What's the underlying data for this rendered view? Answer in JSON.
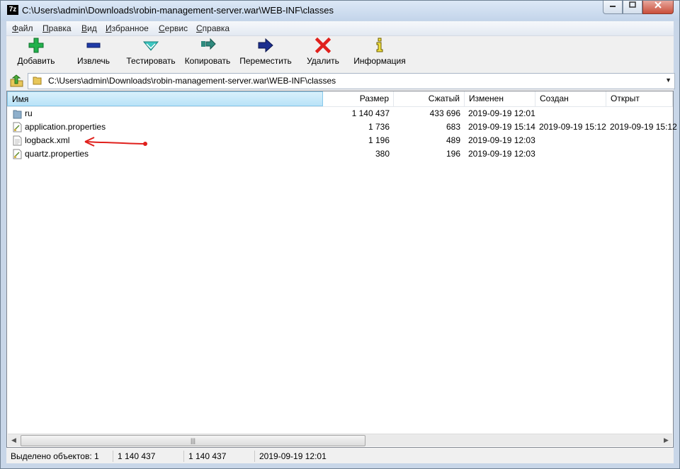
{
  "window": {
    "app_icon": "7z",
    "title": "C:\\Users\\admin\\Downloads\\robin-management-server.war\\WEB-INF\\classes",
    "buttons": [
      "minimize",
      "maximize",
      "close"
    ]
  },
  "menu": [
    {
      "label": "Файл",
      "accel": "Ф",
      "rest": "айл"
    },
    {
      "label": "Правка",
      "accel": "П",
      "rest": "равка"
    },
    {
      "label": "Вид",
      "accel": "В",
      "rest": "ид"
    },
    {
      "label": "Избранное",
      "accel": "И",
      "rest": "збранное"
    },
    {
      "label": "Сервис",
      "accel": "С",
      "rest": "ервис"
    },
    {
      "label": "Справка",
      "accel": "С",
      "rest": "правка"
    }
  ],
  "toolbar": {
    "add": {
      "label": "Добавить",
      "icon": "plus-icon",
      "color": "#22b14c"
    },
    "extract": {
      "label": "Извлечь",
      "icon": "minus-icon",
      "color": "#1f3ba8"
    },
    "test": {
      "label": "Тестировать",
      "icon": "check-down-icon",
      "color": "#3cc6c0"
    },
    "copy": {
      "label": "Копировать",
      "icon": "copy-arrow-icon",
      "color": "#2f8a7e"
    },
    "move": {
      "label": "Переместить",
      "icon": "right-arrow-icon",
      "color": "#1c2f8f"
    },
    "delete": {
      "label": "Удалить",
      "icon": "x-icon",
      "color": "#e0201c"
    },
    "info": {
      "label": "Информация",
      "icon": "info-icon",
      "color": "#f0e040"
    }
  },
  "address": {
    "path": "C:\\Users\\admin\\Downloads\\robin-management-server.war\\WEB-INF\\classes"
  },
  "columns": {
    "name": "Имя",
    "size": "Размер",
    "packed": "Сжатый",
    "modified": "Изменен",
    "created": "Создан",
    "accessed": "Открыт"
  },
  "files": [
    {
      "name": "ru",
      "type": "folder",
      "size": "1 140 437",
      "packed": "433 696",
      "modified": "2019-09-19 12:01",
      "created": "",
      "accessed": ""
    },
    {
      "name": "application.properties",
      "type": "file",
      "size": "1 736",
      "packed": "683",
      "modified": "2019-09-19 15:14",
      "created": "2019-09-19 15:12",
      "accessed": "2019-09-19 15:12"
    },
    {
      "name": "logback.xml",
      "type": "file",
      "size": "1 196",
      "packed": "489",
      "modified": "2019-09-19 12:03",
      "created": "",
      "accessed": ""
    },
    {
      "name": "quartz.properties",
      "type": "file",
      "size": "380",
      "packed": "196",
      "modified": "2019-09-19 12:03",
      "created": "",
      "accessed": ""
    }
  ],
  "status": {
    "selected": "Выделено объектов: 1",
    "size": "1 140 437",
    "packed": "1 140 437",
    "modified": "2019-09-19 12:01"
  },
  "annotation": {
    "color": "#e0201c"
  }
}
